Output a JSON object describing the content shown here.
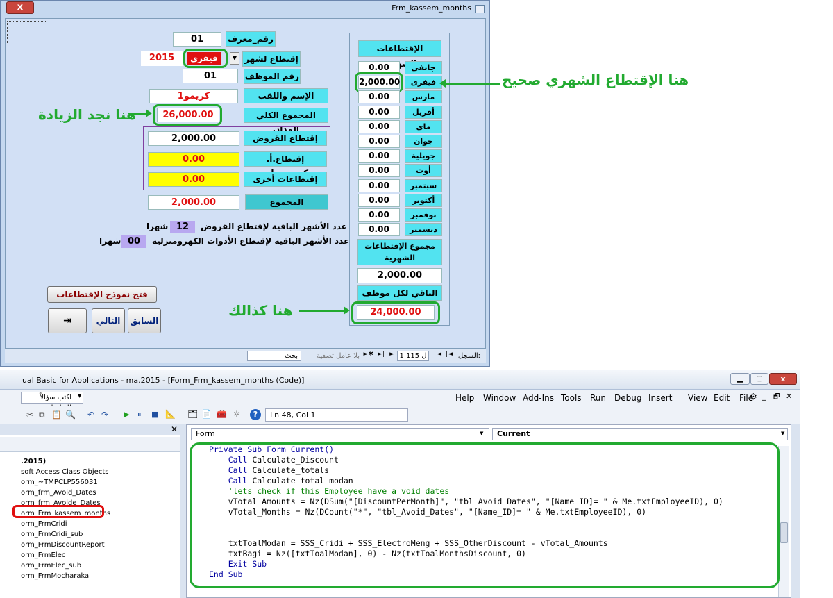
{
  "form": {
    "title": "Frm_kassem_months",
    "close_label": "x",
    "id_label": "رقم_معرف",
    "id_value": "01",
    "deduct_month_label": "إقتطاع لشهر",
    "year": "2015",
    "month_selected": "فيفرى",
    "employee_no_label": "رقم الموظف",
    "employee_no": "01",
    "name_label": "الإسم واللقب",
    "name_value": "كريمو1",
    "total_label": "المجموع الكلي المدان",
    "total_value": "26,000.00",
    "loans_label": "إقتطاع القروض",
    "loans_value": "2,000.00",
    "electro_label": "إقتطاع.أ. كهرومنزلية",
    "electro_value": "0.00",
    "other_label": "إقتطاعات أخرى",
    "other_value": "0.00",
    "sum_label": "المجموع",
    "sum_value": "2,000.00",
    "remaining_loans_text": "عدد الأشهر الباقية لإقتطاع القروض",
    "remaining_loans_value": "12",
    "remaining_loans_unit": "شهرا",
    "remaining_electro_text": "عدد الأشهر الباقية لإقتطاع الأدوات الكهرومنزلية",
    "remaining_electro_value": "00",
    "remaining_electro_unit": "شهرا",
    "open_deductions_button": "فتح نموذج الإقتطاعات",
    "prev_button": "السابق",
    "next_button": "التالي"
  },
  "monthly": {
    "header": "الإقتطاعات الشهرية",
    "months": [
      {
        "label": "جانفى",
        "value": "0.00"
      },
      {
        "label": "فيفرى",
        "value": "2,000.00"
      },
      {
        "label": "مارس",
        "value": "0.00"
      },
      {
        "label": "أفريل",
        "value": "0.00"
      },
      {
        "label": "ماى",
        "value": "0.00"
      },
      {
        "label": "جوان",
        "value": "0.00"
      },
      {
        "label": "جويلية",
        "value": "0.00"
      },
      {
        "label": "أوت",
        "value": "0.00"
      },
      {
        "label": "سبتمبر",
        "value": "0.00"
      },
      {
        "label": "أكتوبر",
        "value": "0.00"
      },
      {
        "label": "نوفمبر",
        "value": "0.00"
      },
      {
        "label": "ديسمبر",
        "value": "0.00"
      }
    ],
    "total_label": "مجموع الإقتطاعات الشهرية",
    "total_value": "2,000.00",
    "remaining_label": "الباقي لكل موظف",
    "remaining_value": "24,000.00"
  },
  "annotations": {
    "monthly_correct": "هنا الإقتطاع الشهري صحيح",
    "increase": "هنا نجد الزيادة",
    "also": "هنا كذالك"
  },
  "navbar": {
    "record_label": "السجل:",
    "record_position": "1 ل 115",
    "filter_label": "بلا عامل تصفية",
    "search_label": "بحث"
  },
  "vbe": {
    "title": "ual Basic for Applications - ma.2015 - [Form_Frm_kassem_months (Code)]",
    "help_box": "اكتب سؤالاً للتعليمات",
    "menu": [
      "Help",
      "Window",
      "Add-Ins",
      "Tools",
      "Run",
      "Debug",
      "Insert",
      "View",
      "Edit",
      "File"
    ],
    "position": "Ln 48, Col 1",
    "object_combo": "Form",
    "proc_combo": "Current",
    "tree": [
      ".2015)",
      "soft Access Class Objects",
      "orm_~TMPCLP556031",
      "orm_frm_Avoid_Dates",
      "orm_frm_Avoide_Dates",
      "orm_Frm_kassem_months",
      "orm_FrmCridi",
      "orm_FrmCridi_sub",
      "orm_FrmDiscountReport",
      "orm_FrmElec",
      "orm_FrmElec_sub",
      "orm_FrmMocharaka"
    ],
    "code": [
      "Private Sub Form_Current()",
      "    Call Calculate_Discount",
      "    Call Calculate_totals",
      "    Call Calculate_total_modan",
      "    'lets check if this Employee have a void dates",
      "    vTotal_Amounts = Nz(DSum(\"[DiscountPerMonth]\", \"tbl_Avoid_Dates\", \"[Name_ID]= \" & Me.txtEmployeeID), 0)",
      "    vTotal_Months = Nz(DCount(\"*\", \"tbl_Avoid_Dates\", \"[Name_ID]= \" & Me.txtEmployeeID), 0)",
      "",
      "",
      "    txtToalModan = SSS_Cridi + SSS_ElectroMeng + SSS_OtherDiscount - vTotal_Amounts",
      "    txtBagi = Nz([txtToalModan], 0) - Nz(txtToalMonthsDiscount, 0)",
      "    Exit Sub",
      "End Sub"
    ]
  }
}
